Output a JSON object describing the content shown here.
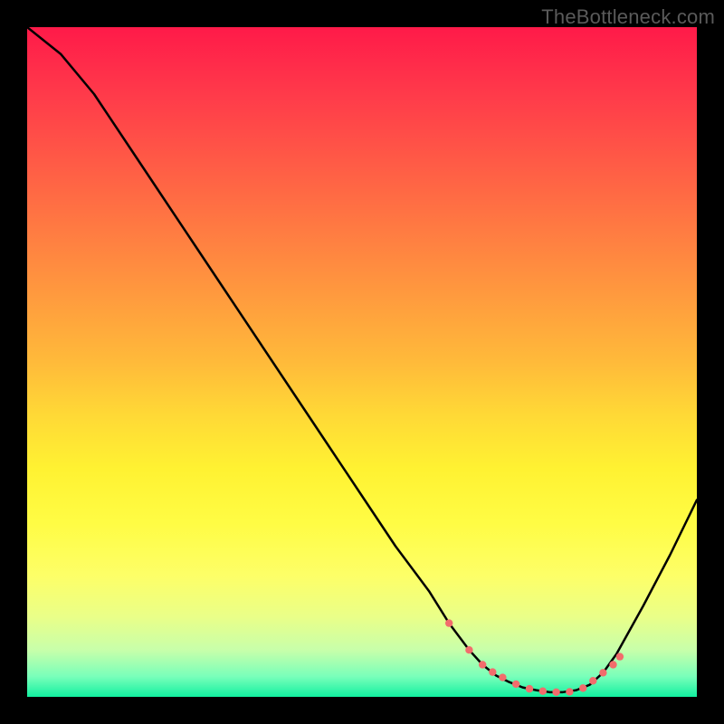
{
  "watermark": "TheBottleneck.com",
  "chart_data": {
    "type": "line",
    "title": "",
    "xlabel": "",
    "ylabel": "",
    "xlim": [
      0,
      100
    ],
    "ylim": [
      0,
      100
    ],
    "series": [
      {
        "name": "bottleneck-curve",
        "x": [
          0,
          5,
          10,
          15,
          20,
          25,
          30,
          35,
          40,
          45,
          50,
          55,
          60,
          63,
          66,
          68,
          70,
          72,
          74,
          76,
          78,
          80,
          82,
          84,
          86,
          88,
          92,
          96,
          100
        ],
        "y": [
          100,
          96,
          90,
          82.5,
          75,
          67.5,
          60,
          52.5,
          45,
          37.5,
          30,
          22.5,
          15.8,
          11,
          7,
          4.8,
          3.2,
          2.2,
          1.4,
          1,
          0.7,
          0.7,
          1,
          1.8,
          3.6,
          6.4,
          13.6,
          21.2,
          29.4
        ]
      }
    ],
    "markers": {
      "name": "highlight-dots",
      "color": "#f26c6c",
      "x": [
        63,
        66,
        68,
        69.5,
        71,
        73,
        75,
        77,
        79,
        81,
        83,
        84.5,
        86,
        87.5,
        88.5
      ],
      "y": [
        11.0,
        7.0,
        4.8,
        3.7,
        2.9,
        1.9,
        1.2,
        0.85,
        0.7,
        0.75,
        1.3,
        2.4,
        3.6,
        4.8,
        6.0
      ]
    }
  }
}
